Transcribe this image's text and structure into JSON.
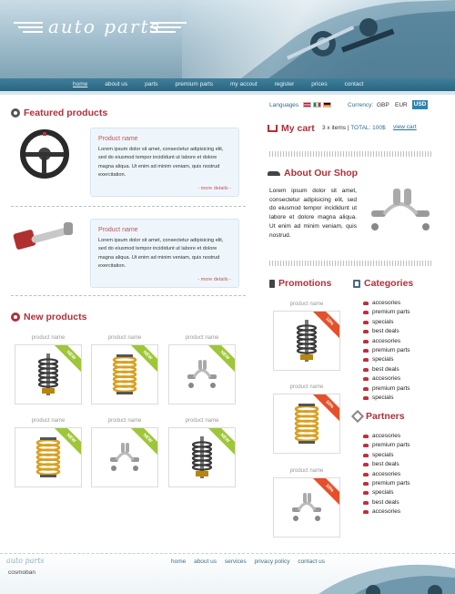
{
  "logo": {
    "text": "auto parts"
  },
  "nav": {
    "items": [
      "home",
      "about us",
      "parts",
      "premium parts",
      "my accout",
      "register",
      "prices",
      "contact"
    ]
  },
  "featured": {
    "title": "Featured products",
    "items": [
      {
        "name": "Product name",
        "desc": "Lorem ipsum dolor sit amet, consectetur adipisicing elit, sed do eiusmod tempor incididunt ut labore et dolore magna aliqua. Ut enim ad minim veniam, quis nostrud exercitation.",
        "more": "- more details -"
      },
      {
        "name": "Product name",
        "desc": "Lorem ipsum dolor sit amet, consectetur adipisicing elit, sed do eiusmod tempor incididunt ut labore et dolore magna aliqua. Ut enim ad minim veniam, quis nostrud exercitation.",
        "more": "- more details -"
      }
    ]
  },
  "new_products": {
    "title": "New products",
    "badge": "NEW",
    "items": [
      {
        "name": "product name",
        "part": "shock-absorber-part"
      },
      {
        "name": "product name",
        "part": "coil-spring-part"
      },
      {
        "name": "product name",
        "part": "exhaust-part"
      },
      {
        "name": "product name",
        "part": "coil-spring-part"
      },
      {
        "name": "product name",
        "part": "exhaust-part"
      },
      {
        "name": "product name",
        "part": "shock-absorber-part"
      }
    ]
  },
  "topbar": {
    "languages_label": "Languages",
    "currency_label": "Currency:",
    "currencies": [
      "GBP",
      "EUR",
      "USD"
    ]
  },
  "cart": {
    "title": "My cart",
    "items": "3 x items",
    "total": "TOTAL: 100$",
    "view": "view cart"
  },
  "about": {
    "title": "About Our Shop",
    "text": "Lorem ipsum dolor sit amet, consectetur adipisicing elit, sed do eiusmod tempor incididunt ut labore et dolore magna aliqua. Ut enim ad minim veniam, quis nostrud."
  },
  "promotions": {
    "title": "Promotions",
    "badge": "10%",
    "items": [
      {
        "name": "product name",
        "part": "shock-absorber-part"
      },
      {
        "name": "product name",
        "part": "coil-spring-part"
      },
      {
        "name": "product name",
        "part": "exhaust-part"
      }
    ]
  },
  "categories": {
    "title": "Categories",
    "items": [
      "accesories",
      "premium parts",
      "specials",
      "best deals",
      "accesories",
      "premium parts",
      "specials",
      "best deals",
      "accesories",
      "premium parts",
      "specials"
    ]
  },
  "partners": {
    "title": "Partners",
    "items": [
      "accesories",
      "premium parts",
      "specials",
      "best deals",
      "accesories",
      "premium parts",
      "specials",
      "best deals",
      "accesories"
    ]
  },
  "footer": {
    "logo": "auto parts",
    "copyright": "cosmoban",
    "links": [
      "home",
      "about us",
      "services",
      "privacy policy",
      "contact us"
    ]
  },
  "colors": {
    "accent_red": "#b0303a",
    "nav_blue": "#2a6580",
    "badge_green": "#9ec638",
    "badge_red": "#e5502a"
  }
}
